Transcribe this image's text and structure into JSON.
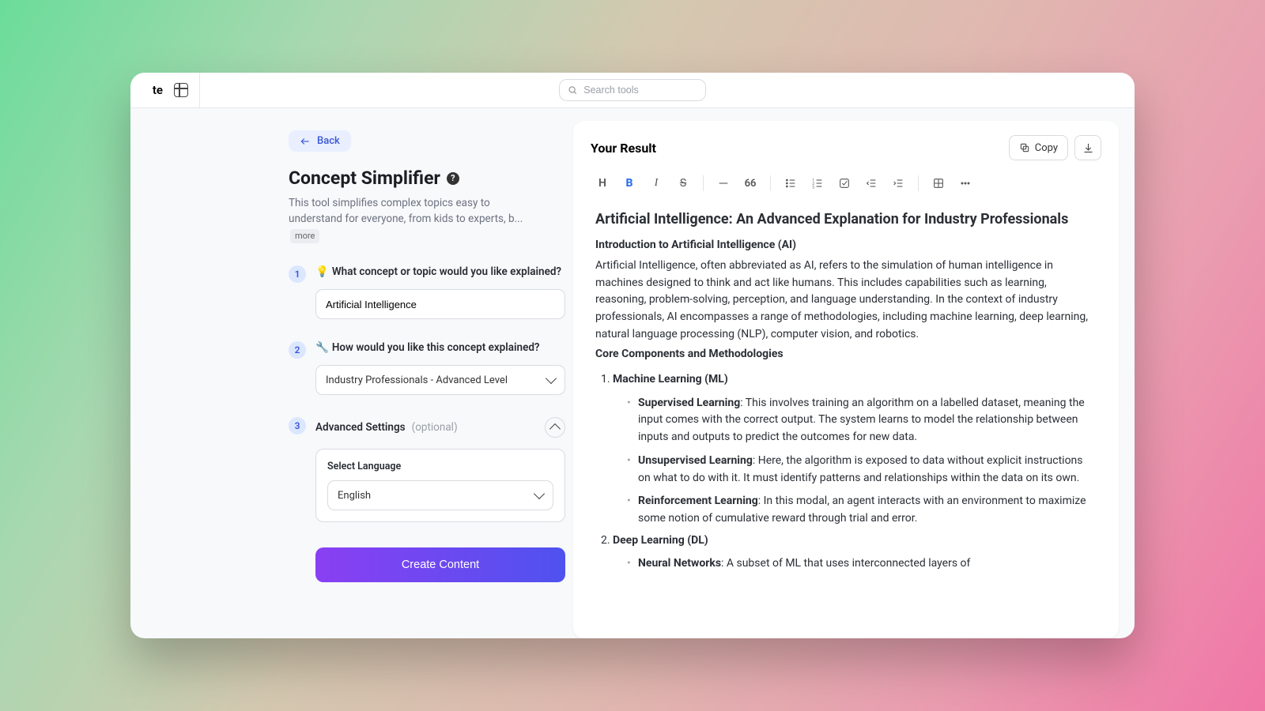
{
  "topbar": {
    "brand_fragment": "te",
    "search_placeholder": "Search tools"
  },
  "left": {
    "back_label": "Back",
    "title": "Concept Simplifier",
    "description": "This tool simplifies complex topics easy to understand for everyone, from kids to experts, b...",
    "more_label": "more",
    "steps": {
      "s1": {
        "num": "1",
        "icon": "💡",
        "label": "What concept or topic would you like explained?",
        "input_value": "Artificial Intelligence"
      },
      "s2": {
        "num": "2",
        "icon": "🔧",
        "label": "How would you like this concept explained?",
        "select_value": "Industry Professionals - Advanced Level"
      },
      "s3": {
        "num": "3",
        "label": "Advanced Settings",
        "optional": "(optional)",
        "lang_label": "Select Language",
        "lang_value": "English"
      }
    },
    "cta_label": "Create Content"
  },
  "result": {
    "header": "Your Result",
    "copy_label": "Copy",
    "title": "Artificial Intelligence: An Advanced Explanation for Industry Professionals",
    "intro_heading": "Introduction to Artificial Intelligence (AI)",
    "intro_body": "Artificial Intelligence, often abbreviated as AI, refers to the simulation of human intelligence in machines designed to think and act like humans. This includes capabilities such as learning, reasoning, problem-solving, perception, and language understanding. In the context of industry professionals, AI encompasses a range of methodologies, including machine learning, deep learning, natural language processing (NLP), computer vision, and robotics.",
    "core_heading": "Core Components and Methodologies",
    "ml": {
      "title": "Machine Learning (ML)",
      "items": [
        {
          "term": "Supervised Learning",
          "body": ": This involves training an algorithm on a labelled dataset, meaning the input comes with the correct output. The system learns to model the relationship between inputs and outputs to predict the outcomes for new data."
        },
        {
          "term": "Unsupervised Learning",
          "body": ": Here, the algorithm is exposed to data without explicit instructions on what to do with it. It must identify patterns and relationships within the data on its own."
        },
        {
          "term": "Reinforcement Learning",
          "body": ": In this modal, an agent interacts with an environment to maximize some notion of cumulative reward through trial and error."
        }
      ]
    },
    "dl": {
      "title": "Deep Learning (DL)",
      "items": [
        {
          "term": "Neural Networks",
          "body": ": A subset of ML that uses interconnected layers of"
        }
      ]
    }
  }
}
